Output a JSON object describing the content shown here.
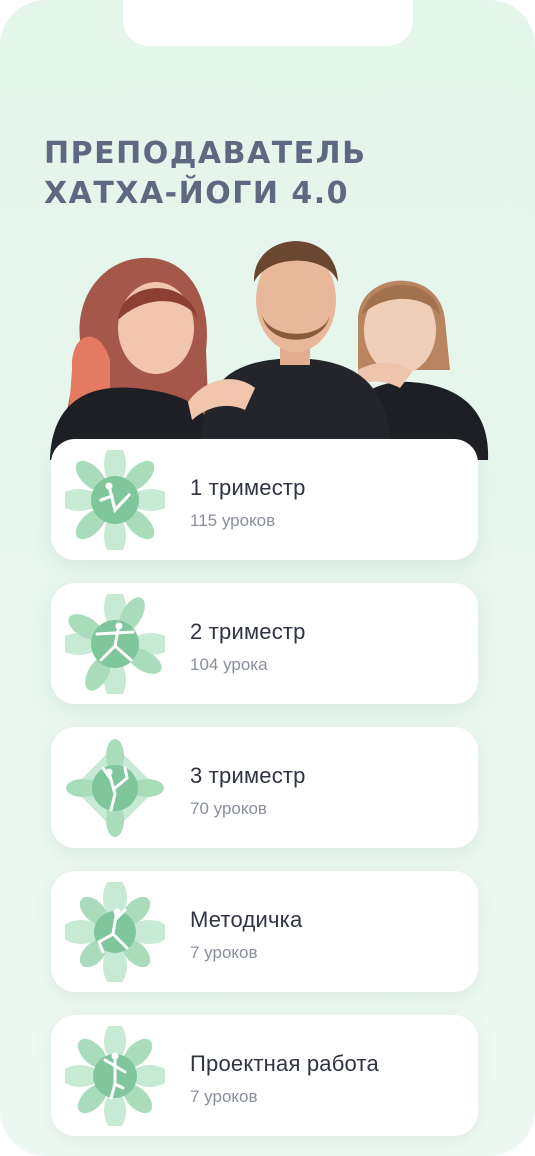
{
  "header": {
    "title_line1": "ПРЕПОДАВАТЕЛЬ",
    "title_line2": "ХАТХА-ЙОГИ 4.0"
  },
  "hero": {
    "icon": "instructors-photo"
  },
  "courses": [
    {
      "title": "1 триместр",
      "lessons": "115 уроков",
      "icon": "yoga-boat-pose-icon"
    },
    {
      "title": "2 триместр",
      "lessons": "104 урока",
      "icon": "yoga-warrior-pose-icon"
    },
    {
      "title": "3 триместр",
      "lessons": "70 уроков",
      "icon": "yoga-dancer-pose-icon"
    },
    {
      "title": "Методичка",
      "lessons": "7 уроков",
      "icon": "yoga-lunge-pose-icon"
    },
    {
      "title": "Проектная работа",
      "lessons": "7 уроков",
      "icon": "yoga-standing-pose-icon"
    }
  ],
  "colors": {
    "background": "#e4f5ea",
    "title": "#5f6880",
    "emblem_light": "#d3efdd",
    "emblem_mid": "#a8dcbb",
    "emblem_dark": "#7fc79b"
  }
}
